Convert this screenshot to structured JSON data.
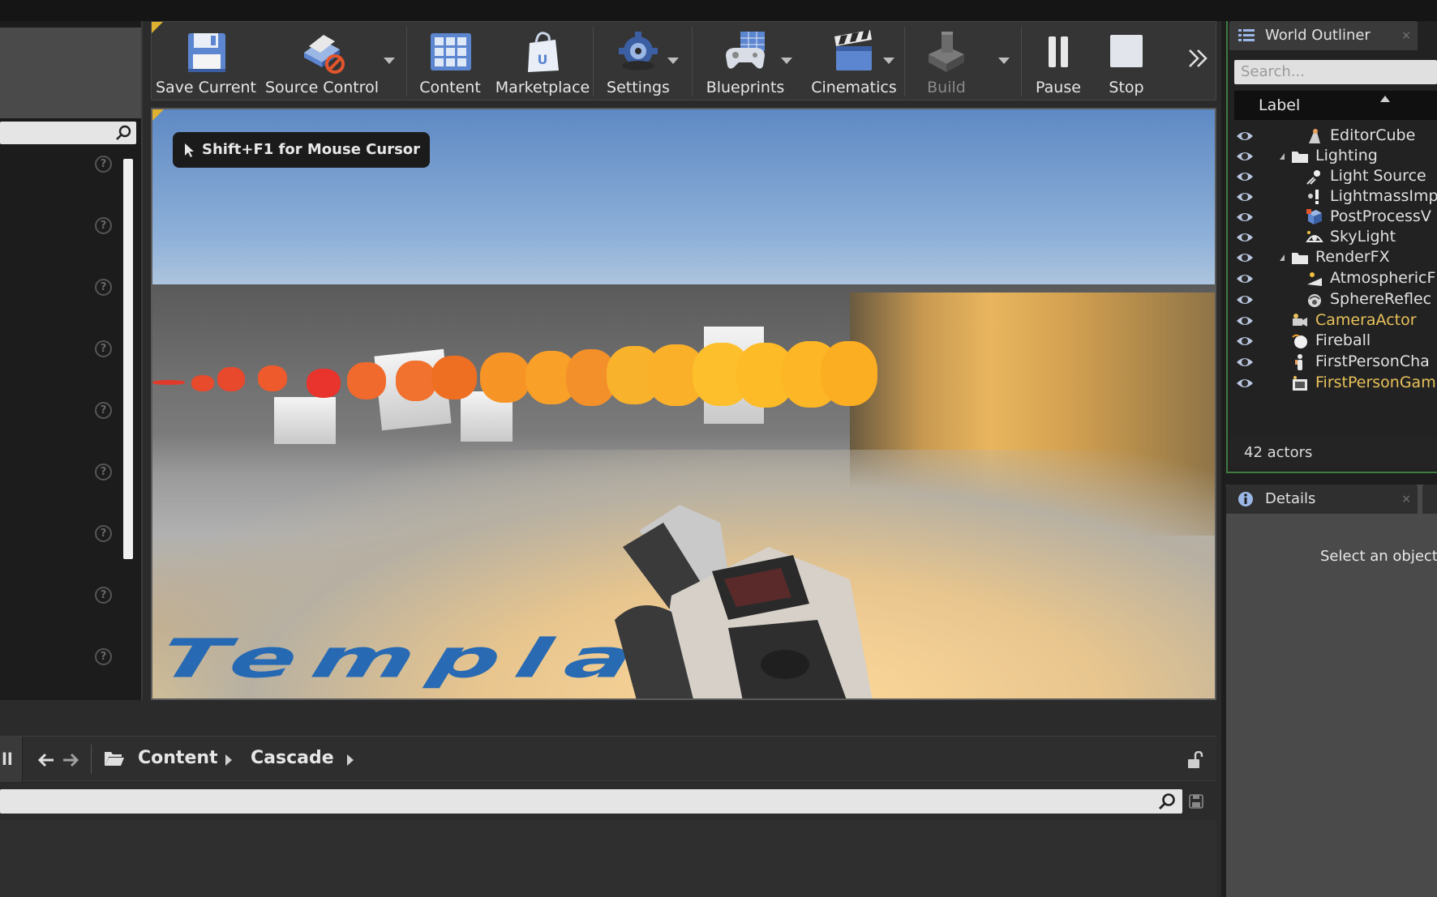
{
  "toolbar": {
    "buttons": [
      {
        "label": "Save Current",
        "icon": "floppy-disk-icon"
      },
      {
        "label": "Source Control",
        "icon": "source-control-icon"
      },
      {
        "label": "Content",
        "icon": "content-grid-icon"
      },
      {
        "label": "Marketplace",
        "icon": "marketplace-bag-icon"
      },
      {
        "label": "Settings",
        "icon": "settings-gear-icon"
      },
      {
        "label": "Blueprints",
        "icon": "blueprints-gamepad-icon"
      },
      {
        "label": "Cinematics",
        "icon": "clapperboard-icon"
      },
      {
        "label": "Build",
        "icon": "build-blocks-icon",
        "disabled": true
      },
      {
        "label": "Pause",
        "icon": "pause-icon"
      },
      {
        "label": "Stop",
        "icon": "stop-icon"
      }
    ]
  },
  "viewport": {
    "hint": "Shift+F1 for Mouse Cursor",
    "floor_text": "Template"
  },
  "content_browser": {
    "left_stub": "ll",
    "breadcrumbs": [
      "Content",
      "Cascade"
    ]
  },
  "world_outliner": {
    "tab_label": "World Outliner",
    "search_placeholder": "Search...",
    "column_label": "Label",
    "rows": [
      {
        "label": "EditorCube",
        "icon": "static-mesh-icon",
        "indent": 2
      },
      {
        "label": "Lighting",
        "icon": "folder-icon",
        "indent": 1,
        "expanded": true
      },
      {
        "label": "Light Source",
        "icon": "directional-light-icon",
        "indent": 2
      },
      {
        "label": "LightmassImp",
        "icon": "lightmass-importance-icon",
        "indent": 2
      },
      {
        "label": "PostProcessV",
        "icon": "post-process-volume-icon",
        "indent": 2
      },
      {
        "label": "SkyLight",
        "icon": "skylight-icon",
        "indent": 2
      },
      {
        "label": "RenderFX",
        "icon": "folder-icon",
        "indent": 1,
        "expanded": true
      },
      {
        "label": "AtmosphericF",
        "icon": "atmospheric-fog-icon",
        "indent": 2
      },
      {
        "label": "SphereReflec",
        "icon": "sphere-reflection-icon",
        "indent": 2
      },
      {
        "label": "CameraActor",
        "icon": "camera-actor-icon",
        "indent": 1,
        "gold": true
      },
      {
        "label": "Fireball",
        "icon": "fireball-icon",
        "indent": 1
      },
      {
        "label": "FirstPersonCha",
        "icon": "character-icon",
        "indent": 1
      },
      {
        "label": "FirstPersonGam",
        "icon": "game-mode-icon",
        "indent": 1,
        "gold": true
      }
    ],
    "footer": "42 actors"
  },
  "details": {
    "tab_label": "Details",
    "hint": "Select an object"
  },
  "colors": {
    "accent_gold": "#e0b030",
    "outliner_border": "#3f7a3f",
    "gold_text": "#e8c15a"
  }
}
